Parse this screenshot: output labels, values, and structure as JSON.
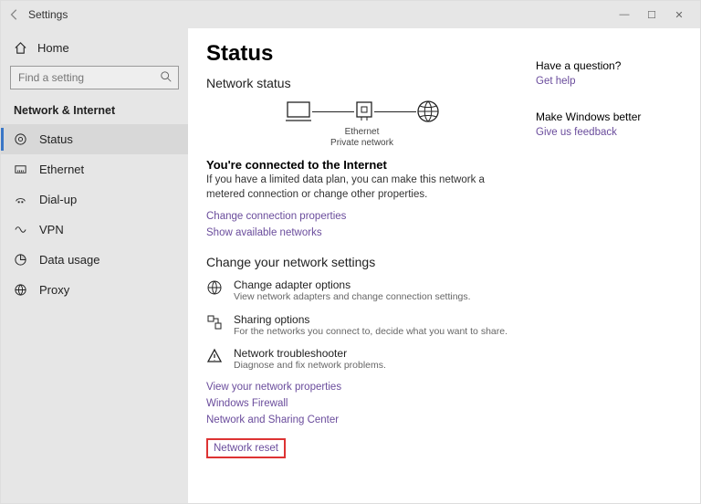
{
  "titlebar": {
    "title": "Settings"
  },
  "sidebar": {
    "home": "Home",
    "search_placeholder": "Find a setting",
    "category": "Network & Internet",
    "items": [
      {
        "label": "Status"
      },
      {
        "label": "Ethernet"
      },
      {
        "label": "Dial-up"
      },
      {
        "label": "VPN"
      },
      {
        "label": "Data usage"
      },
      {
        "label": "Proxy"
      }
    ]
  },
  "page": {
    "title": "Status",
    "section1": "Network status",
    "diagram": {
      "label1": "Ethernet",
      "label2": "Private network"
    },
    "connected_title": "You're connected to the Internet",
    "connected_desc": "If you have a limited data plan, you can make this network a metered connection or change other properties.",
    "link_change_props": "Change connection properties",
    "link_show_networks": "Show available networks",
    "section2": "Change your network settings",
    "opts": [
      {
        "title": "Change adapter options",
        "desc": "View network adapters and change connection settings."
      },
      {
        "title": "Sharing options",
        "desc": "For the networks you connect to, decide what you want to share."
      },
      {
        "title": "Network troubleshooter",
        "desc": "Diagnose and fix network problems."
      }
    ],
    "link_view_props": "View your network properties",
    "link_firewall": "Windows Firewall",
    "link_sharing_center": "Network and Sharing Center",
    "link_reset": "Network reset"
  },
  "help": {
    "q_title": "Have a question?",
    "q_link": "Get help",
    "f_title": "Make Windows better",
    "f_link": "Give us feedback"
  }
}
